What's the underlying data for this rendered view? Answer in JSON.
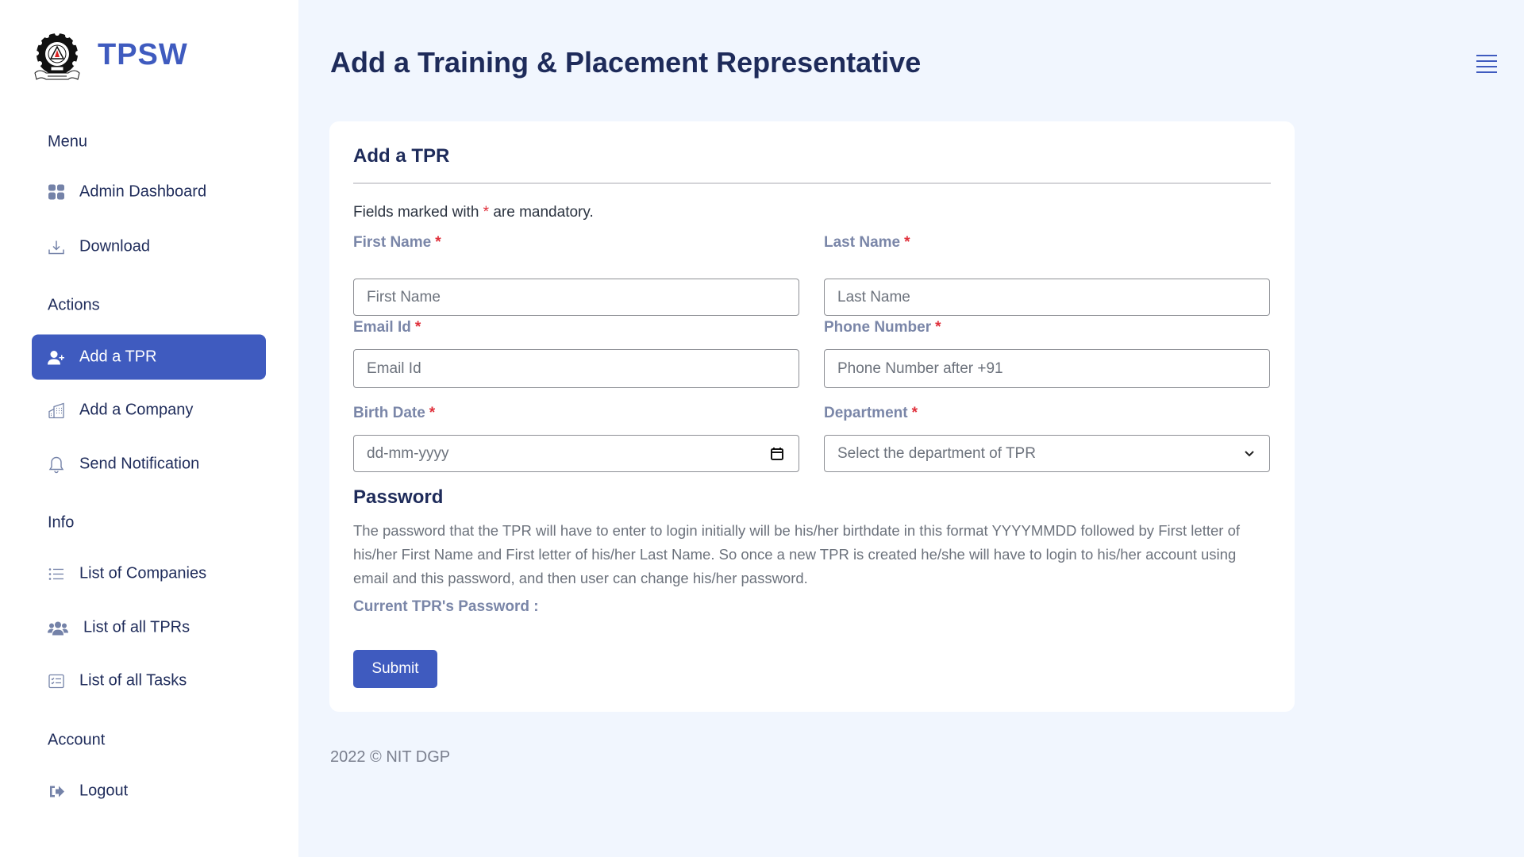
{
  "brand": {
    "name": "TPSW",
    "logo": "nit-dgp-emblem"
  },
  "colors": {
    "primary": "#3f5bbf",
    "text": "#1e2b5a",
    "label": "#7a86a8",
    "required": "#e0303b",
    "background": "#f1f6fe"
  },
  "sidebar": {
    "sections": [
      {
        "label": "Menu"
      },
      {
        "label": "Actions"
      },
      {
        "label": "Info"
      },
      {
        "label": "Account"
      }
    ],
    "items": [
      {
        "label": "Admin Dashboard",
        "icon": "grid-icon",
        "active": false
      },
      {
        "label": "Download",
        "icon": "download-icon",
        "active": false
      },
      {
        "label": "Add a TPR",
        "icon": "user-plus-icon",
        "active": true
      },
      {
        "label": "Add a Company",
        "icon": "building-icon",
        "active": false
      },
      {
        "label": "Send Notification",
        "icon": "bell-icon",
        "active": false
      },
      {
        "label": "List of Companies",
        "icon": "list-icon",
        "active": false
      },
      {
        "label": "List of all TPRs",
        "icon": "users-icon",
        "active": false
      },
      {
        "label": "List of all Tasks",
        "icon": "tasks-icon",
        "active": false
      },
      {
        "label": "Logout",
        "icon": "logout-icon",
        "active": false
      }
    ]
  },
  "header": {
    "title": "Add a Training & Placement Representative",
    "menu_icon": "hamburger-icon"
  },
  "form": {
    "title": "Add a TPR",
    "mandatory_prefix": "Fields marked with",
    "mandatory_star": "*",
    "mandatory_suffix": "are mandatory.",
    "fields": {
      "first_name": {
        "label": "First Name",
        "placeholder": "First Name",
        "value": ""
      },
      "last_name": {
        "label": "Last Name",
        "placeholder": "Last Name",
        "value": ""
      },
      "email": {
        "label": "Email Id",
        "placeholder": "Email Id",
        "value": ""
      },
      "phone": {
        "label": "Phone Number",
        "placeholder": "Phone Number after +91",
        "value": ""
      },
      "birth_date": {
        "label": "Birth Date",
        "placeholder": "dd-mm-yyyy",
        "value": ""
      },
      "department": {
        "label": "Department",
        "selected": "Select the department of TPR"
      }
    },
    "password": {
      "heading": "Password",
      "description": "The password that the TPR will have to enter to login initially will be his/her birthdate in this format YYYYMMDD followed by First letter of his/her First Name and First letter of his/her Last Name. So once a new TPR is created he/she will have to login to his/her account using email and this password, and then user can change his/her password.",
      "current_label": "Current TPR's Password :",
      "current_value": ""
    },
    "submit_label": "Submit"
  },
  "footer": {
    "text": "2022 © NIT DGP"
  }
}
